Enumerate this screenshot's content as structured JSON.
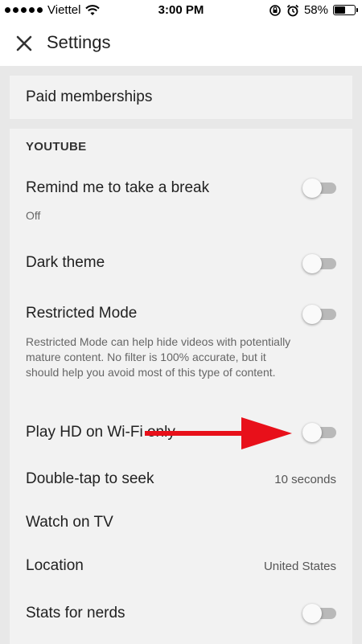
{
  "status_bar": {
    "carrier": "Viettel",
    "time": "3:00 PM",
    "battery_percent": "58%",
    "battery_level": 0.58,
    "icons": [
      "signal-dots-icon",
      "wifi-icon",
      "rotation-lock-icon",
      "alarm-icon",
      "battery-icon"
    ]
  },
  "app_bar": {
    "title": "Settings",
    "close_icon": "close-icon"
  },
  "paid": {
    "label": "Paid memberships"
  },
  "youtube": {
    "header": "YOUTUBE",
    "remind": {
      "label": "Remind me to take a break",
      "sub": "Off",
      "on": false
    },
    "dark": {
      "label": "Dark theme",
      "on": false
    },
    "restricted": {
      "label": "Restricted Mode",
      "description": "Restricted Mode can help hide videos with potentially mature content. No filter is 100% accurate, but it should help you avoid most of this type of content.",
      "on": false
    },
    "hd": {
      "label": "Play HD on Wi-Fi only",
      "on": false
    },
    "doubletap": {
      "label": "Double-tap to seek",
      "value": "10 seconds"
    },
    "tv": {
      "label": "Watch on TV"
    },
    "location": {
      "label": "Location",
      "value": "United States"
    },
    "stats": {
      "label": "Stats for nerds",
      "on": false
    }
  },
  "colors": {
    "annotation_arrow": "#e8101a",
    "toggle_off_track": "#b9b9b9",
    "card_background": "#f2f2f2",
    "page_background": "#e8e8e8"
  }
}
